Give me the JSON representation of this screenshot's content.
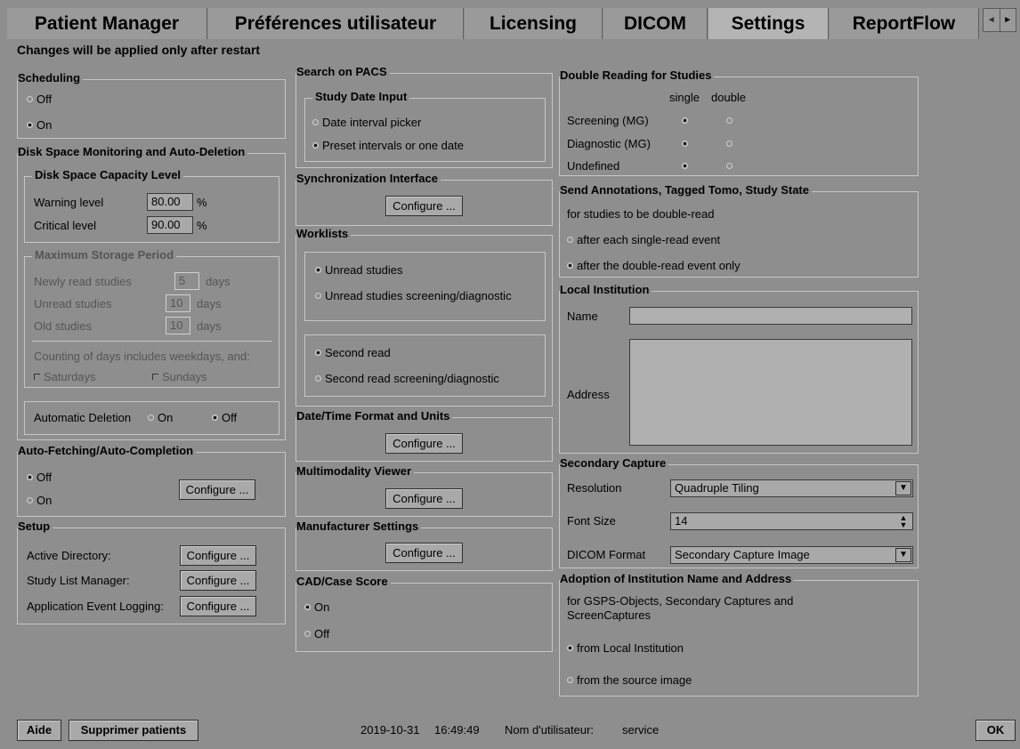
{
  "tabs": [
    "Patient Manager",
    "Préférences utilisateur",
    "Licensing",
    "DICOM",
    "Settings",
    "ReportFlow"
  ],
  "tab_scroll": {
    "left": "◄",
    "right": "►"
  },
  "restart_note": "Changes will be applied only after restart",
  "scheduling": {
    "title": "Scheduling",
    "off": "Off",
    "on": "On"
  },
  "disk": {
    "title": "Disk Space Monitoring and Auto-Deletion",
    "capacity_title": "Disk Space Capacity Level",
    "warning_label": "Warning level",
    "warning_value": "80.00",
    "warning_unit": "%",
    "critical_label": "Critical level",
    "critical_value": "90.00",
    "critical_unit": "%",
    "storage_title": "Maximum Storage Period",
    "newly_label": "Newly read studies",
    "newly_value": "5",
    "newly_unit": "days",
    "unread_label": "Unread studies",
    "unread_value": "10",
    "unread_unit": "days",
    "old_label": "Old studies",
    "old_value": "10",
    "old_unit": "days",
    "counting": "Counting of days includes weekdays, and:",
    "saturdays": "Saturdays",
    "sundays": "Sundays",
    "autodelete_label": "Automatic Deletion",
    "autodelete_on": "On",
    "autodelete_off": "Off"
  },
  "autofetch": {
    "title": "Auto-Fetching/Auto-Completion",
    "off": "Off",
    "on": "On",
    "configure": "Configure ..."
  },
  "setup": {
    "title": "Setup",
    "active_directory": "Active Directory:",
    "study_list_manager": "Study List Manager:",
    "event_logging": "Application Event Logging:",
    "configure": "Configure ..."
  },
  "pacs": {
    "title": "Search on PACS",
    "date_input_title": "Study Date Input",
    "interval_picker": "Date interval picker",
    "preset": "Preset intervals or one date"
  },
  "sync": {
    "title": "Synchronization Interface",
    "configure": "Configure ..."
  },
  "worklists": {
    "title": "Worklists",
    "unread": "Unread studies",
    "unread_sd": "Unread studies screening/diagnostic",
    "second": "Second read",
    "second_sd": "Second read screening/diagnostic"
  },
  "datetime": {
    "title": "Date/Time Format and Units",
    "configure": "Configure ..."
  },
  "multimodality": {
    "title": "Multimodality Viewer",
    "configure": "Configure ..."
  },
  "manufacturer": {
    "title": "Manufacturer Settings",
    "configure": "Configure ..."
  },
  "cad": {
    "title": "CAD/Case Score",
    "on": "On",
    "off": "Off"
  },
  "double_reading": {
    "title": "Double Reading for Studies",
    "col_single": "single",
    "col_double": "double",
    "rows": [
      "Screening (MG)",
      "Diagnostic (MG)",
      "Undefined"
    ]
  },
  "send_annotations": {
    "title": "Send Annotations, Tagged Tomo, Study State",
    "desc": "for studies to be double-read",
    "after_single": "after each single-read event",
    "after_double": "after the double-read event only"
  },
  "institution": {
    "title": "Local Institution",
    "name_label": "Name",
    "address_label": "Address",
    "name_value": "",
    "address_value": ""
  },
  "secondary_capture": {
    "title": "Secondary Capture",
    "resolution_label": "Resolution",
    "resolution_value": "Quadruple Tiling",
    "font_label": "Font Size",
    "font_value": "14",
    "format_label": "DICOM Format",
    "format_value": "Secondary Capture Image"
  },
  "adoption": {
    "title": "Adoption of Institution Name and Address",
    "desc": "for GSPS-Objects, Secondary Captures and ScreenCaptures",
    "from_local": "from Local Institution",
    "from_source": "from the source image"
  },
  "footer": {
    "help": "Aide",
    "delete_patients": "Supprimer patients",
    "date": "2019-10-31",
    "time": "16:49:49",
    "user_label": "Nom d'utilisateur:",
    "user": "service",
    "ok": "OK"
  }
}
